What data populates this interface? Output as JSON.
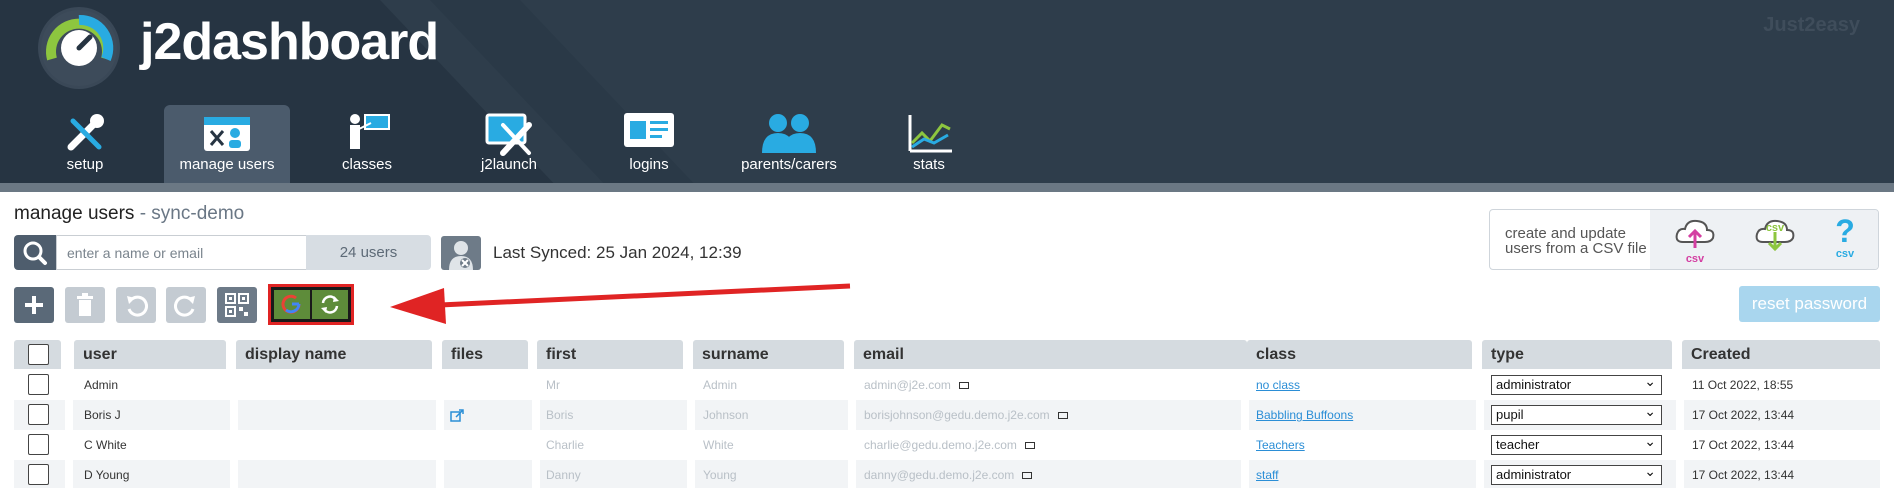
{
  "header": {
    "logo_text": "j2dashboard",
    "brand": "Just2easy",
    "nav": [
      {
        "label": "setup",
        "icon": "tools-icon",
        "active": false
      },
      {
        "label": "manage users",
        "icon": "users-icon",
        "active": true
      },
      {
        "label": "classes",
        "icon": "classroom-icon",
        "active": false
      },
      {
        "label": "j2launch",
        "icon": "launch-icon",
        "active": false
      },
      {
        "label": "logins",
        "icon": "id-card-icon",
        "active": false
      },
      {
        "label": "parents/carers",
        "icon": "parents-icon",
        "active": false
      },
      {
        "label": "stats",
        "icon": "stats-icon",
        "active": false
      }
    ]
  },
  "page": {
    "title": "manage users",
    "subtitle": "- sync-demo"
  },
  "search": {
    "placeholder": "enter a name or email",
    "count": "24 users"
  },
  "sync": {
    "text": "Last Synced: 25 Jan 2024, 12:39"
  },
  "csv": {
    "line1": "create and update",
    "line2": "users from a CSV file",
    "labels": [
      "csv",
      "csv",
      "csv"
    ]
  },
  "toolbar": {
    "reset_label": "reset password"
  },
  "table": {
    "headers": [
      "user",
      "display name",
      "files",
      "first",
      "surname",
      "email",
      "class",
      "type",
      "Created"
    ],
    "rows": [
      {
        "user": "Admin",
        "display": "",
        "files": false,
        "first": "Mr",
        "surname": "Admin",
        "email": "admin@j2e.com",
        "class": "no class",
        "type": "administrator",
        "created": "11 Oct 2022, 18:55"
      },
      {
        "user": "Boris J",
        "display": "",
        "files": true,
        "first": "Boris",
        "surname": "Johnson",
        "email": "borisjohnson@gedu.demo.j2e.com",
        "class": "Babbling Buffoons",
        "type": "pupil",
        "created": "17 Oct 2022, 13:44"
      },
      {
        "user": "C White",
        "display": "",
        "files": false,
        "first": "Charlie",
        "surname": "White",
        "email": "charlie@gedu.demo.j2e.com",
        "class": "Teachers",
        "type": "teacher",
        "created": "17 Oct 2022, 13:44"
      },
      {
        "user": "D Young",
        "display": "",
        "files": false,
        "first": "Danny",
        "surname": "Young",
        "email": "danny@gedu.demo.j2e.com",
        "class": "staff",
        "type": "administrator",
        "created": "17 Oct 2022, 13:44"
      }
    ]
  },
  "colors": {
    "header_bg": "#263442",
    "accent_blue": "#2b8ed6",
    "highlight_red": "#e02424",
    "google_green": "#5e8c3a"
  }
}
